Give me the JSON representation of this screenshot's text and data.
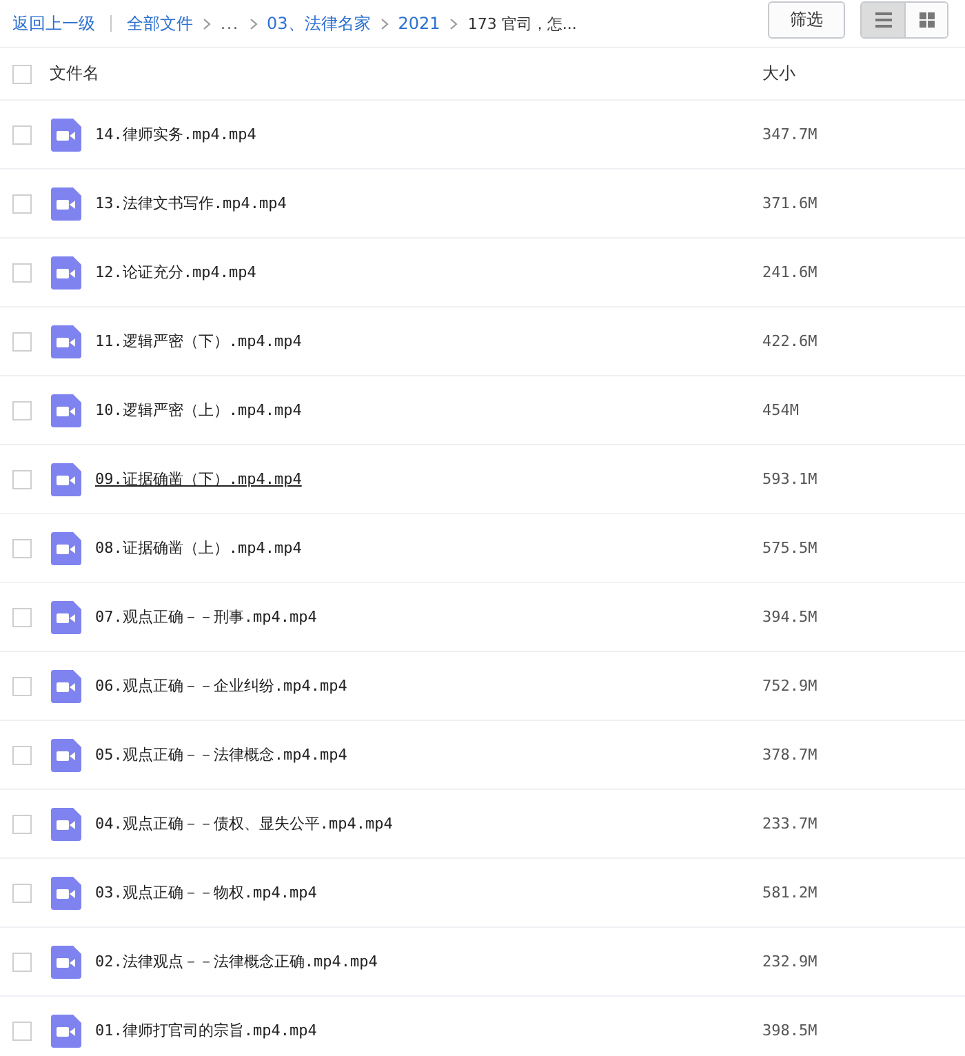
{
  "toolbar": {
    "back_link": "返回上一级",
    "breadcrumbs": [
      {
        "label": "全部文件",
        "kind": "link"
      },
      {
        "label": "...",
        "kind": "plain"
      },
      {
        "label": "03、法律名家",
        "kind": "link"
      },
      {
        "label": "2021",
        "kind": "link"
      },
      {
        "label": "173 官司，怎...",
        "kind": "current"
      }
    ],
    "filter_button": "筛选",
    "views": [
      {
        "kind": "list",
        "selected": true
      },
      {
        "kind": "grid",
        "selected": false
      }
    ]
  },
  "table": {
    "select_all": {
      "checked": false
    },
    "columns": [
      "文件名",
      "大小"
    ],
    "rows": [
      {
        "name": "14.律师实务.mp4.mp4",
        "size": "347.7M",
        "checked": false,
        "hovered": false
      },
      {
        "name": "13.法律文书写作.mp4.mp4",
        "size": "371.6M",
        "checked": false,
        "hovered": false
      },
      {
        "name": "12.论证充分.mp4.mp4",
        "size": "241.6M",
        "checked": false,
        "hovered": false
      },
      {
        "name": "11.逻辑严密（下）.mp4.mp4",
        "size": "422.6M",
        "checked": false,
        "hovered": false
      },
      {
        "name": "10.逻辑严密（上）.mp4.mp4",
        "size": "454M",
        "checked": false,
        "hovered": false
      },
      {
        "name": "09.证据确凿（下）.mp4.mp4",
        "size": "593.1M",
        "checked": false,
        "hovered": true
      },
      {
        "name": "08.证据确凿（上）.mp4.mp4",
        "size": "575.5M",
        "checked": false,
        "hovered": false
      },
      {
        "name": "07.观点正确－－刑事.mp4.mp4",
        "size": "394.5M",
        "checked": false,
        "hovered": false
      },
      {
        "name": "06.观点正确－－企业纠纷.mp4.mp4",
        "size": "752.9M",
        "checked": false,
        "hovered": false
      },
      {
        "name": "05.观点正确－－法律概念.mp4.mp4",
        "size": "378.7M",
        "checked": false,
        "hovered": false
      },
      {
        "name": "04.观点正确－－债权、显失公平.mp4.mp4",
        "size": "233.7M",
        "checked": false,
        "hovered": false
      },
      {
        "name": "03.观点正确－－物权.mp4.mp4",
        "size": "581.2M",
        "checked": false,
        "hovered": false
      },
      {
        "name": "02.法律观点－－法律概念正确.mp4.mp4",
        "size": "232.9M",
        "checked": false,
        "hovered": false
      },
      {
        "name": "01.律师打官司的宗旨.mp4.mp4",
        "size": "398.5M",
        "checked": false,
        "hovered": false
      }
    ]
  }
}
